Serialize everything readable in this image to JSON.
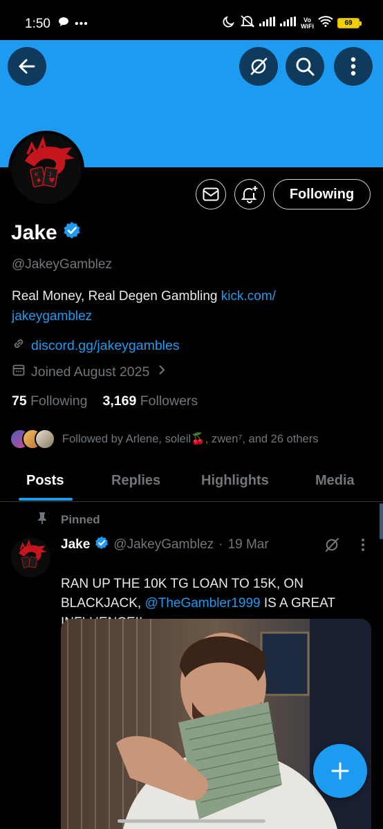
{
  "status_bar": {
    "time": "1:50",
    "battery": "69",
    "network_label_top": "Vo",
    "network_label_bottom": "WiFi"
  },
  "profile": {
    "name": "Jake",
    "handle": "@JakeyGamblez",
    "bio_text": "Real Money, Real Degen Gambling ",
    "bio_link_1": "kick.com/",
    "bio_link_2": "jakeygamblez",
    "website": "discord.gg/jakeygambles",
    "joined": "Joined August 2025",
    "following_count": "75",
    "following_label": "Following",
    "followers_count": "3,169",
    "followers_label": "Followers",
    "followed_by": "Followed by Arlene, soleil🍒, zwen⁷, and 26 others",
    "follow_button": "Following"
  },
  "tabs": [
    "Posts",
    "Replies",
    "Highlights",
    "Media"
  ],
  "active_tab": "Posts",
  "post": {
    "pinned_label": "Pinned",
    "author": "Jake",
    "handle": "@JakeyGamblez",
    "separator": "·",
    "date": "19 Mar",
    "text_before": "RAN UP THE 10K TG LOAN TO 15K, ON BLACKJACK, ",
    "mention": "@TheGambler1999",
    "text_after": "  IS A GREAT INFLUENCE!!"
  },
  "colors": {
    "accent": "#1d9bf0",
    "background": "#000000",
    "secondary_text": "#71767b"
  }
}
